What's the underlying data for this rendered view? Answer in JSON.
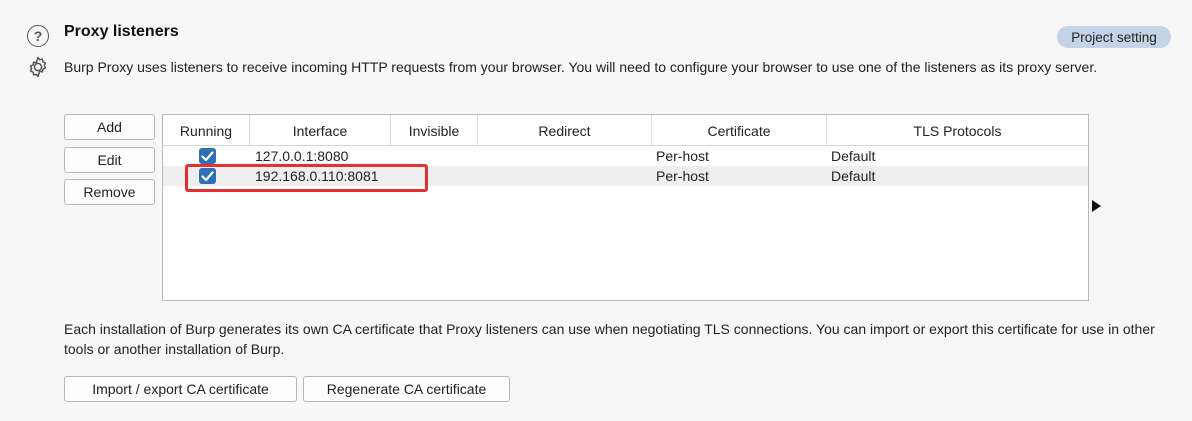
{
  "section": {
    "title": "Proxy listeners",
    "badge": "Project setting",
    "description": "Burp Proxy uses listeners to receive incoming HTTP requests from your browser. You will need to configure your browser to use one of the listeners as its proxy server.",
    "help_icon_glyph": "?",
    "icons": [
      "help-icon",
      "gear-icon"
    ]
  },
  "listener_buttons": {
    "add": "Add",
    "edit": "Edit",
    "remove": "Remove"
  },
  "table": {
    "columns": [
      "Running",
      "Interface",
      "Invisible",
      "Redirect",
      "Certificate",
      "TLS Protocols"
    ],
    "rows": [
      {
        "running": true,
        "interface": "127.0.0.1:8080",
        "invisible": "",
        "redirect": "",
        "certificate": "Per-host",
        "tls_protocols": "Default"
      },
      {
        "running": true,
        "interface": "192.168.0.110:8081",
        "invisible": "",
        "redirect": "",
        "certificate": "Per-host",
        "tls_protocols": "Default",
        "selected": true
      }
    ]
  },
  "ca_section": {
    "text": "Each installation of Burp generates its own CA certificate that Proxy listeners can use when negotiating TLS connections. You can import or export this certificate for use in other tools or another installation of Burp.",
    "import_export_label": "Import / export CA certificate",
    "regenerate_label": "Regenerate CA certificate"
  },
  "colors": {
    "accent_checkbox": "#2f6fb5",
    "badge_bg": "#c5d3e6",
    "highlight_box": "#e53030"
  }
}
